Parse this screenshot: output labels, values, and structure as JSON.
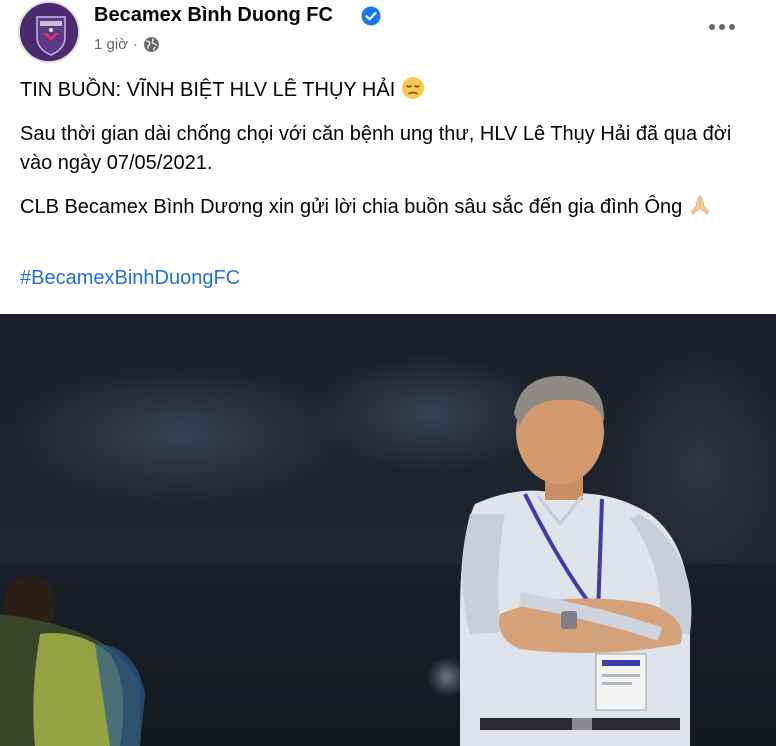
{
  "page": {
    "name": "Becamex Bình Duong FC",
    "time": "1 giờ",
    "separator": "·"
  },
  "post": {
    "title": "TIN BUỒN: VĨNH BIỆT HLV LÊ THỤY HẢI",
    "paragraph1": "Sau thời gian dài chống chọi với căn bệnh ung thư, HLV Lê Thụy Hải đã qua đời vào ngày 07/05/2021.",
    "paragraph2": "CLB Becamex Bình Dương xin gửi lời chia buồn sâu sắc đến gia đình Ông",
    "hashtag": "#BecamexBinhDuongFC"
  },
  "icons": {
    "verified": "verified-badge-icon",
    "audience": "globe-icon",
    "more": "more-options-icon",
    "title_emoji": "sad-face-emoji",
    "end_emoji": "folded-hands-emoji"
  },
  "colors": {
    "text": "#050505",
    "meta": "#65676b",
    "link": "#216fdb",
    "verified": "#1877f2",
    "avatar": "#4a2a6e"
  }
}
